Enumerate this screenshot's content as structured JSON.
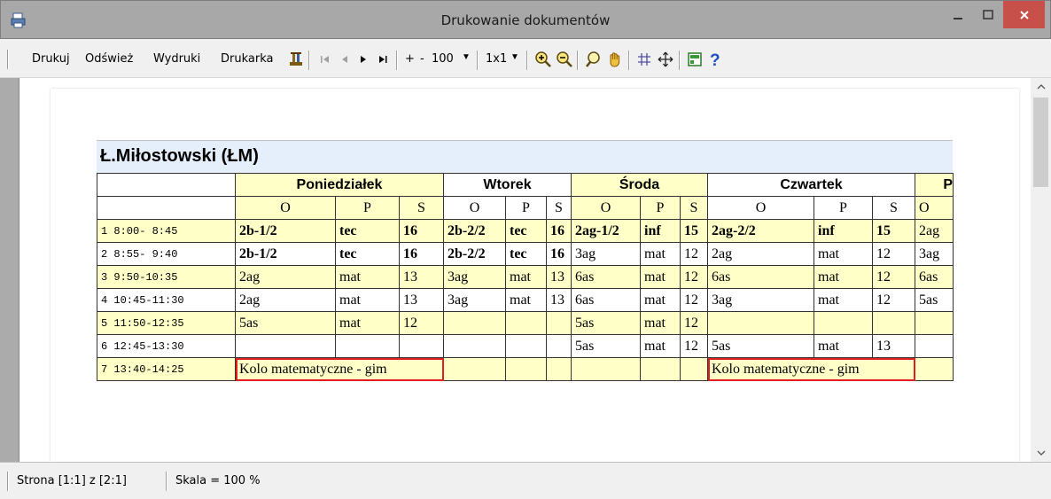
{
  "window": {
    "title": "Drukowanie dokumentów"
  },
  "toolbar": {
    "print_label": "Drukuj",
    "refresh_label": "Odśwież",
    "printouts_label": "Wydruki",
    "printer_label": "Drukarka",
    "zoom_plus": "+",
    "zoom_minus": "-",
    "zoom_value": "100",
    "layout_value": "1x1"
  },
  "schedule": {
    "teacher": "Ł.Miłostowski (ŁM)",
    "days": [
      "Poniedziałek",
      "Wtorek",
      "Środa",
      "Czwartek",
      "P"
    ],
    "subheaders": [
      "O",
      "P",
      "S"
    ],
    "rows": [
      {
        "lesson": "1  8:00- 8:45",
        "mon": [
          "2b-1/2",
          "tec",
          "16"
        ],
        "tue": [
          "2b-2/2",
          "tec",
          "16"
        ],
        "wed": [
          "2ag-1/2",
          "inf",
          "15"
        ],
        "thu": [
          "2ag-2/2",
          "inf",
          "15"
        ],
        "fri": "2ag"
      },
      {
        "lesson": "2  8:55- 9:40",
        "mon": [
          "2b-1/2",
          "tec",
          "16"
        ],
        "tue": [
          "2b-2/2",
          "tec",
          "16"
        ],
        "wed": [
          "3ag",
          "mat",
          "12"
        ],
        "thu": [
          "2ag",
          "mat",
          "12"
        ],
        "fri": "3ag"
      },
      {
        "lesson": "3  9:50-10:35",
        "mon": [
          "2ag",
          "mat",
          "13"
        ],
        "tue": [
          "3ag",
          "mat",
          "13"
        ],
        "wed": [
          "6as",
          "mat",
          "12"
        ],
        "thu": [
          "6as",
          "mat",
          "12"
        ],
        "fri": "6as"
      },
      {
        "lesson": "4 10:45-11:30",
        "mon": [
          "2ag",
          "mat",
          "13"
        ],
        "tue": [
          "3ag",
          "mat",
          "13"
        ],
        "wed": [
          "6as",
          "mat",
          "12"
        ],
        "thu": [
          "3ag",
          "mat",
          "12"
        ],
        "fri": "5as"
      },
      {
        "lesson": "5 11:50-12:35",
        "mon": [
          "5as",
          "mat",
          "12"
        ],
        "tue": [
          "",
          "",
          ""
        ],
        "wed": [
          "5as",
          "mat",
          "12"
        ],
        "thu": [
          "",
          "",
          ""
        ],
        "fri": ""
      },
      {
        "lesson": "6 12:45-13:30",
        "mon": [
          "",
          "",
          ""
        ],
        "tue": [
          "",
          "",
          ""
        ],
        "wed": [
          "5as",
          "mat",
          "12"
        ],
        "thu": [
          "5as",
          "mat",
          "13"
        ],
        "fri": ""
      },
      {
        "lesson": "7 13:40-14:25",
        "mon_merged": "Kolo matematyczne - gim",
        "tue": [
          "",
          "",
          ""
        ],
        "wed": [
          "",
          "",
          ""
        ],
        "thu_merged": "Kolo matematyczne - gim",
        "fri": ""
      }
    ]
  },
  "status": {
    "page_text": "Strona [1:1] z [2:1]",
    "scale_text": "Skala = 100 %"
  }
}
